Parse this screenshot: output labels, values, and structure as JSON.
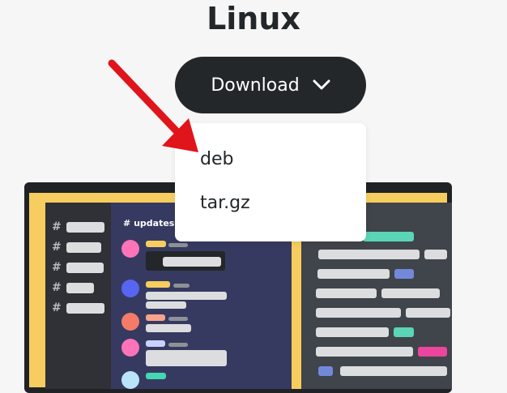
{
  "page": {
    "title": "Linux"
  },
  "download": {
    "label": "Download",
    "icon": "chevron-down-icon"
  },
  "dropdown": {
    "items": [
      "deb",
      "tar.gz"
    ]
  },
  "annotation": {
    "color": "#e0141b"
  },
  "illustration": {
    "channel_name": "updates",
    "channel_symbol": "#",
    "colors": {
      "frame": "#f6cd5e",
      "server_list": "#2f3136",
      "channel_list": "#363a60",
      "chat_area": "#40444b",
      "placeholder": "#dcddde"
    }
  }
}
